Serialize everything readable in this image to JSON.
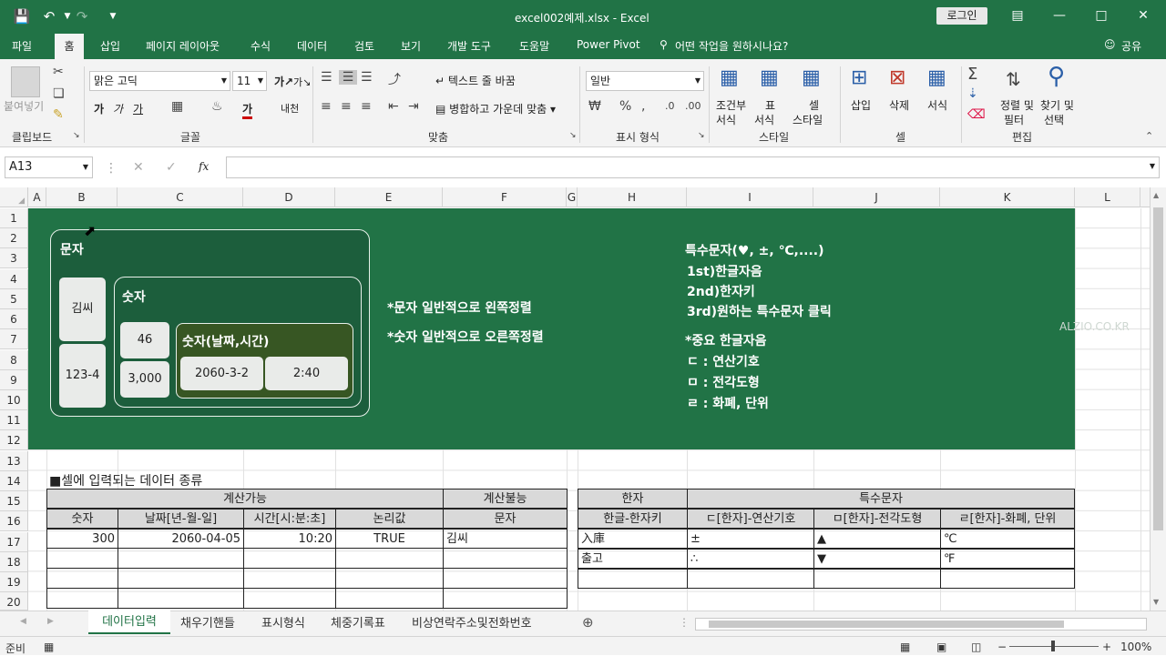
{
  "window": {
    "title": "excel002예제.xlsx  -  Excel",
    "login": "로그인"
  },
  "ribbon_tabs": [
    "파일",
    "홈",
    "삽입",
    "페이지 레이아웃",
    "수식",
    "데이터",
    "검토",
    "보기",
    "개발 도구",
    "도움말",
    "Power Pivot",
    "어떤 작업을 원하시나요?",
    "공유"
  ],
  "ribbon": {
    "paste": "붙여넣기",
    "clipboard": "클립보드",
    "font_name": "맑은 고딕",
    "font_size": "11",
    "font_group": "글꼴",
    "wrap": "텍스트 줄 바꿈",
    "merge": "병합하고 가운데 맞춤",
    "align_group": "맞춤",
    "num_format": "일반",
    "num_group": "표시 형식",
    "cond": [
      "조건부",
      "서식"
    ],
    "table": [
      "표",
      "서식"
    ],
    "cellstyle": [
      "셀",
      "스타일"
    ],
    "style_group": "스타일",
    "insert": "삽입",
    "delete": "삭제",
    "format": "서식",
    "cell_group": "셀",
    "sort": [
      "정렬 및",
      "필터"
    ],
    "find": [
      "찾기 및",
      "선택"
    ],
    "edit_group": "편집",
    "ga": "가",
    "gal": "가",
    "gang": "가",
    "under": "가",
    "ligature": "내천"
  },
  "formula": {
    "namebox": "A13",
    "fx": "fx"
  },
  "columns": [
    "A",
    "B",
    "C",
    "D",
    "E",
    "F",
    "G",
    "H",
    "I",
    "J",
    "K",
    "L"
  ],
  "rows": [
    "1",
    "2",
    "3",
    "4",
    "5",
    "6",
    "7",
    "8",
    "9",
    "10",
    "11",
    "12",
    "13",
    "14",
    "15",
    "16",
    "17",
    "18",
    "19",
    "20"
  ],
  "banner": {
    "munja": "문자",
    "kim": "김씨",
    "num1": "123-4",
    "sutja": "숫자",
    "n46": "46",
    "n3000": "3,000",
    "date_title": "숫자(날짜,시간)",
    "date": "2060-3-2",
    "time": "2:40",
    "note1": "*문자 일반적으로 왼쪽정렬",
    "note2": "*숫자 일반적으로 오른쪽정렬",
    "sp_title": "특수문자(♥, ±, ℃,....)",
    "sp1": "1st)한글자음",
    "sp2": "2nd)한자키",
    "sp3": "3rd)원하는 특수문자 클릭",
    "imp": "*중요 한글자음",
    "imp1": "ㄷ : 연산기호",
    "imp2": "ㅁ : 전각도형",
    "imp3": "ㄹ : 화폐, 단위",
    "watermark": "ALZIO.CO.KR"
  },
  "section_title": "■셀에 입력되는 데이터 종류",
  "table1": {
    "group1": "계산가능",
    "group2": "계산불능",
    "headers": [
      "숫자",
      "날짜[년-월-일]",
      "시간[시:분:초]",
      "논리값",
      "문자"
    ],
    "row": [
      "300",
      "2060-04-05",
      "10:20",
      "TRUE",
      "김씨"
    ]
  },
  "table2": {
    "group1": "한자",
    "group2": "특수문자",
    "headers": [
      "한글-한자키",
      "ㄷ[한자]-연산기호",
      "ㅁ[한자]-전각도형",
      "ㄹ[한자]-화폐, 단위"
    ],
    "rows": [
      [
        "入庫",
        "±",
        "▲",
        "℃"
      ],
      [
        "출고",
        "∴",
        "▼",
        "℉"
      ]
    ]
  },
  "sheets": [
    "데이터입력",
    "채우기핸들",
    "표시형식",
    "체중기록표",
    "비상연락주소및전화번호"
  ],
  "status": {
    "ready": "준비",
    "zoom": "100%"
  }
}
